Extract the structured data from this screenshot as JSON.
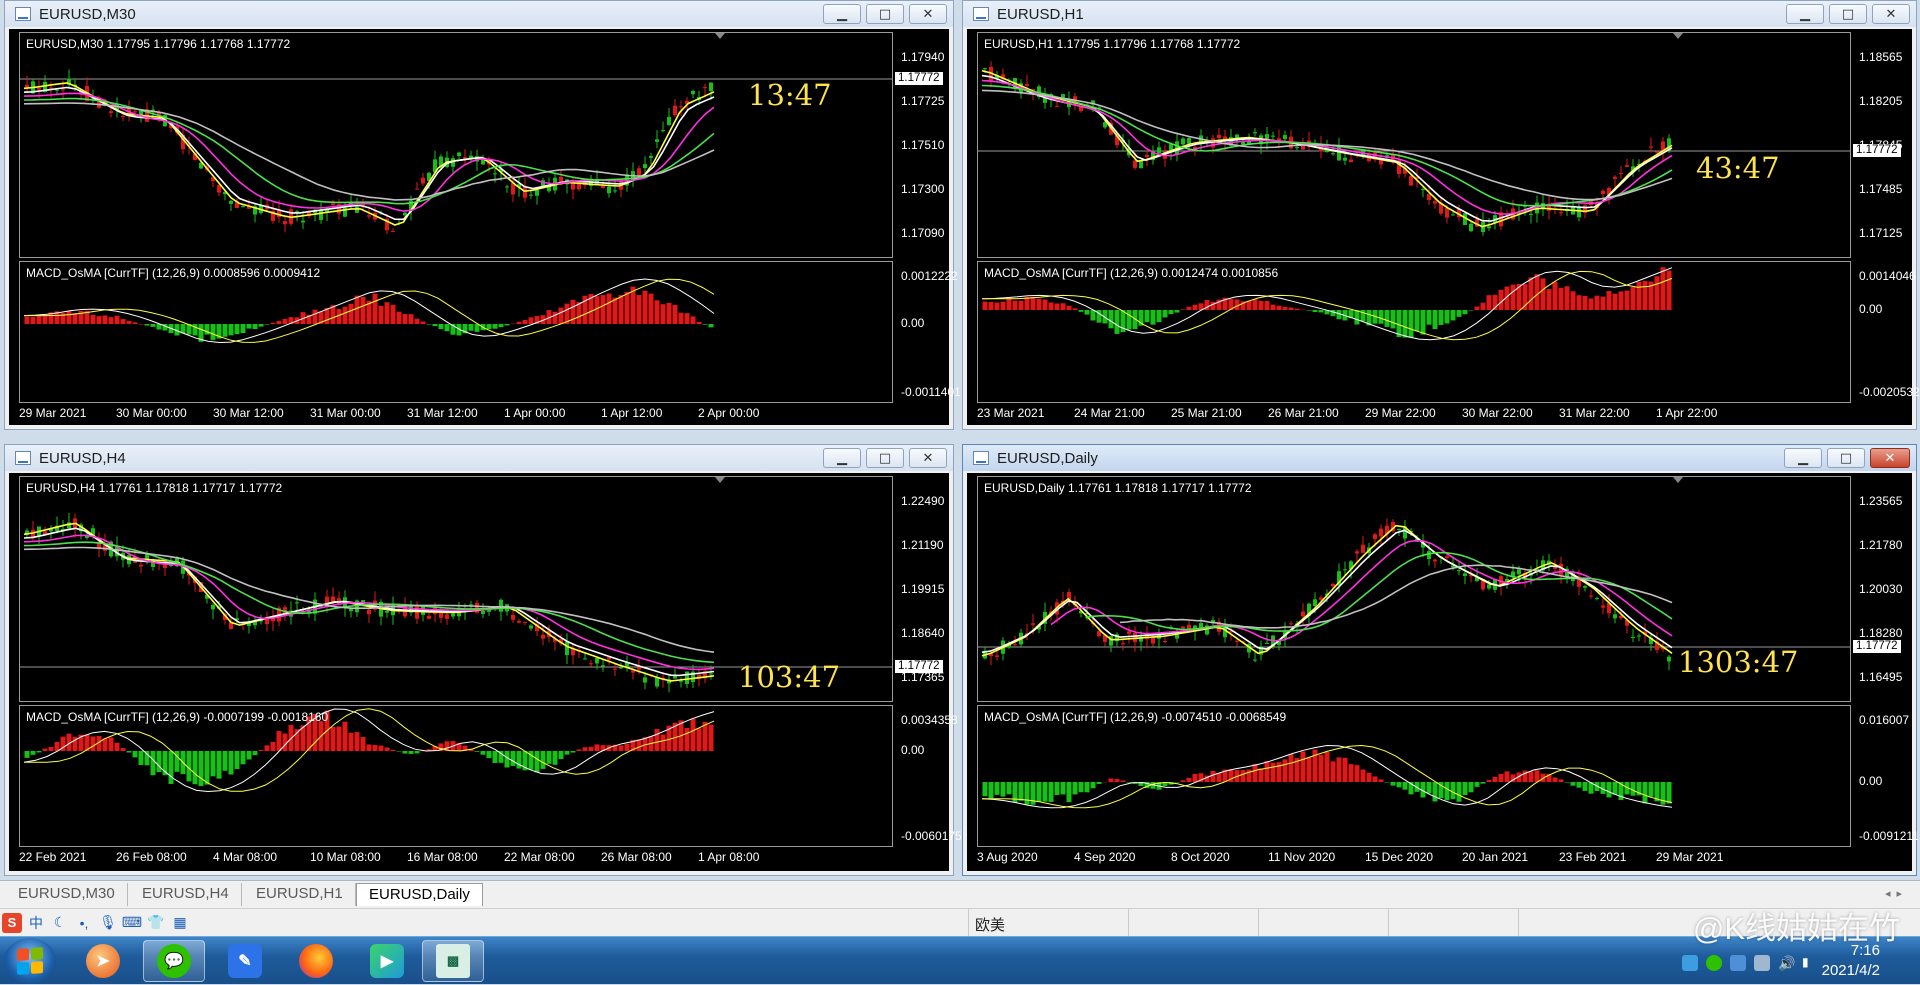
{
  "windows": [
    {
      "id": "m30",
      "title": "EURUSD,M30",
      "info": "EURUSD,M30  1.17795 1.17796 1.17768 1.17772",
      "price_scale": [
        "1.17940",
        "1.17725",
        "1.17510",
        "1.17300",
        "1.17090"
      ],
      "current_price": "1.17772",
      "timer": "13:47",
      "macd_info": "MACD_OsMA [CurrTF] (12,26,9) 0.0008596 0.0009412",
      "macd_scale": [
        "0.0012222",
        "0.00",
        "-0.0011401"
      ],
      "dates": [
        "29 Mar 2021",
        "30 Mar 00:00",
        "30 Mar 12:00",
        "31 Mar 00:00",
        "31 Mar 12:00",
        "1 Apr 00:00",
        "1 Apr 12:00",
        "2 Apr 00:00"
      ],
      "active": false
    },
    {
      "id": "h1",
      "title": "EURUSD,H1",
      "info": "EURUSD,H1  1.17795 1.17796 1.17768 1.17772",
      "price_scale": [
        "1.18565",
        "1.18205",
        "1.17845",
        "1.17485",
        "1.17125"
      ],
      "current_price": "1.17772",
      "timer": "43:47",
      "macd_info": "MACD_OsMA [CurrTF] (12,26,9) 0.0012474 0.0010856",
      "macd_scale": [
        "0.0014046",
        "0.00",
        "-0.0020532"
      ],
      "dates": [
        "23 Mar 2021",
        "24 Mar 21:00",
        "25 Mar 21:00",
        "26 Mar 21:00",
        "29 Mar 22:00",
        "30 Mar 22:00",
        "31 Mar 22:00",
        "1 Apr 22:00"
      ],
      "active": false
    },
    {
      "id": "h4",
      "title": "EURUSD,H4",
      "info": "EURUSD,H4  1.17761 1.17818 1.17717 1.17772",
      "price_scale": [
        "1.22490",
        "1.21190",
        "1.19915",
        "1.18640",
        "1.17365"
      ],
      "current_price": "1.17772",
      "timer": "103:47",
      "macd_info": "MACD_OsMA [CurrTF] (12,26,9) -0.0007199 -0.0018160",
      "macd_scale": [
        "0.0034358",
        "0.00",
        "-0.0060175"
      ],
      "dates": [
        "22 Feb 2021",
        "26 Feb 08:00",
        "4 Mar 08:00",
        "10 Mar 08:00",
        "16 Mar 08:00",
        "22 Mar 08:00",
        "26 Mar 08:00",
        "1 Apr 08:00"
      ],
      "active": false
    },
    {
      "id": "d1",
      "title": "EURUSD,Daily",
      "info": "EURUSD,Daily  1.17761 1.17818 1.17717 1.17772",
      "price_scale": [
        "1.23565",
        "1.21780",
        "1.20030",
        "1.18280",
        "1.16495"
      ],
      "current_price": "1.17772",
      "timer": "1303:47",
      "macd_info": "MACD_OsMA [CurrTF] (12,26,9) -0.0074510 -0.0068549",
      "macd_scale": [
        "0.016007",
        "0.00",
        "-0.0091211"
      ],
      "dates": [
        "3 Aug 2020",
        "4 Sep 2020",
        "8 Oct 2020",
        "11 Nov 2020",
        "15 Dec 2020",
        "20 Jan 2021",
        "23 Feb 2021",
        "29 Mar 2021"
      ],
      "active": true
    }
  ],
  "tabs": [
    "EURUSD,M30",
    "EURUSD,H4",
    "EURUSD,H1",
    "EURUSD,Daily"
  ],
  "active_tab": "EURUSD,Daily",
  "status": {
    "profile": "欧美"
  },
  "ime": {
    "logo": "S",
    "mode": "中"
  },
  "taskbar": {
    "apps": [
      "firefox-like app",
      "wechat",
      "feishu",
      "firefox",
      "video player",
      "pattern app"
    ]
  },
  "clock": {
    "time": "7:16",
    "date": "2021/4/2"
  },
  "watermark": "@K线姑姑在竹",
  "colors": {
    "bull": "#16c016",
    "bear": "#e01818",
    "ma_fast": "#ffff40",
    "ma_white": "#ffffff",
    "ma_magenta": "#ff30e0",
    "ma_green": "#4ce04c",
    "ma_gray": "#c0c0c0",
    "timer": "#ffe34d"
  }
}
